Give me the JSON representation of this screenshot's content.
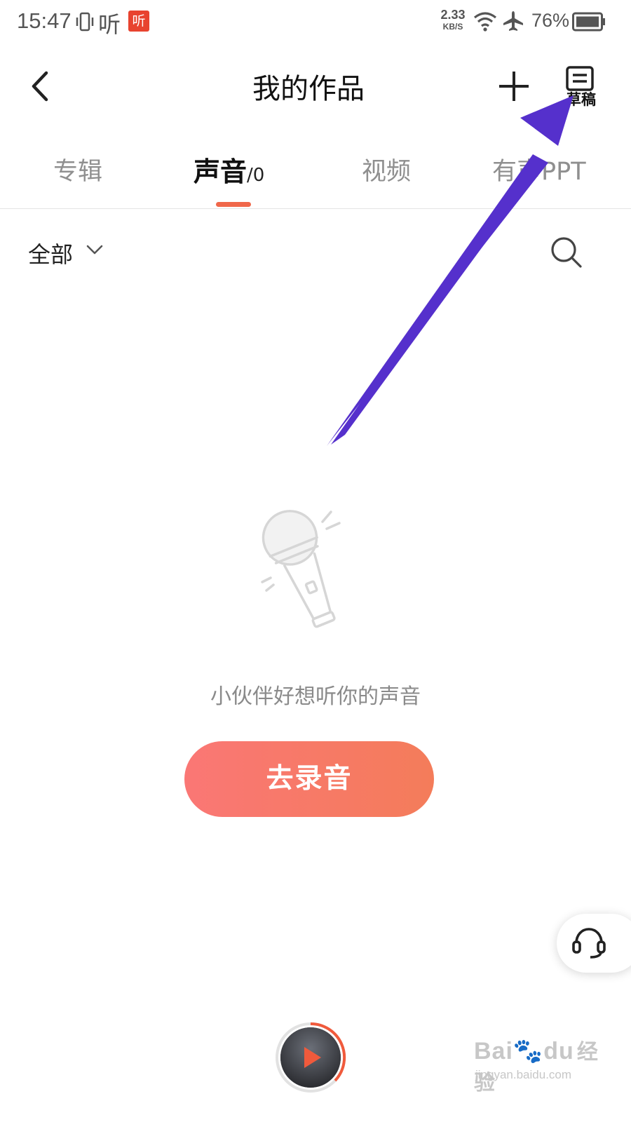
{
  "status_bar": {
    "time": "15:47",
    "ting_glyph": "听",
    "app_badge": "听",
    "net_speed_value": "2.33",
    "net_speed_unit": "KB/S",
    "battery_percent": "76%",
    "icons": [
      "vibrate-icon",
      "wifi-icon",
      "airplane-icon",
      "battery-icon"
    ]
  },
  "header": {
    "title": "我的作品",
    "draft_label": "草稿",
    "icons": [
      "back-icon",
      "plus-icon",
      "draft-icon"
    ]
  },
  "tabs": {
    "items": [
      {
        "label": "专辑"
      },
      {
        "label": "声音",
        "count": "/0",
        "active": true
      },
      {
        "label": "视频"
      },
      {
        "label": "有声PPT"
      }
    ]
  },
  "filter": {
    "label": "全部",
    "icons": [
      "chevron-down-icon",
      "search-icon"
    ]
  },
  "empty_state": {
    "message": "小伙伴好想听你的声音",
    "button_label": "去录音",
    "illustration": "microphone-icon"
  },
  "watermark": {
    "brand": "Bai",
    "brand_suffix": "du",
    "brand_cn": "经验",
    "url": "jingyan.baidu.com"
  },
  "colors": {
    "accent": "#f0674a",
    "button_gradient_start": "#fa7775",
    "button_gradient_end": "#f47c5a",
    "annotation_arrow": "#5530cc",
    "app_badge": "#e8432f"
  }
}
